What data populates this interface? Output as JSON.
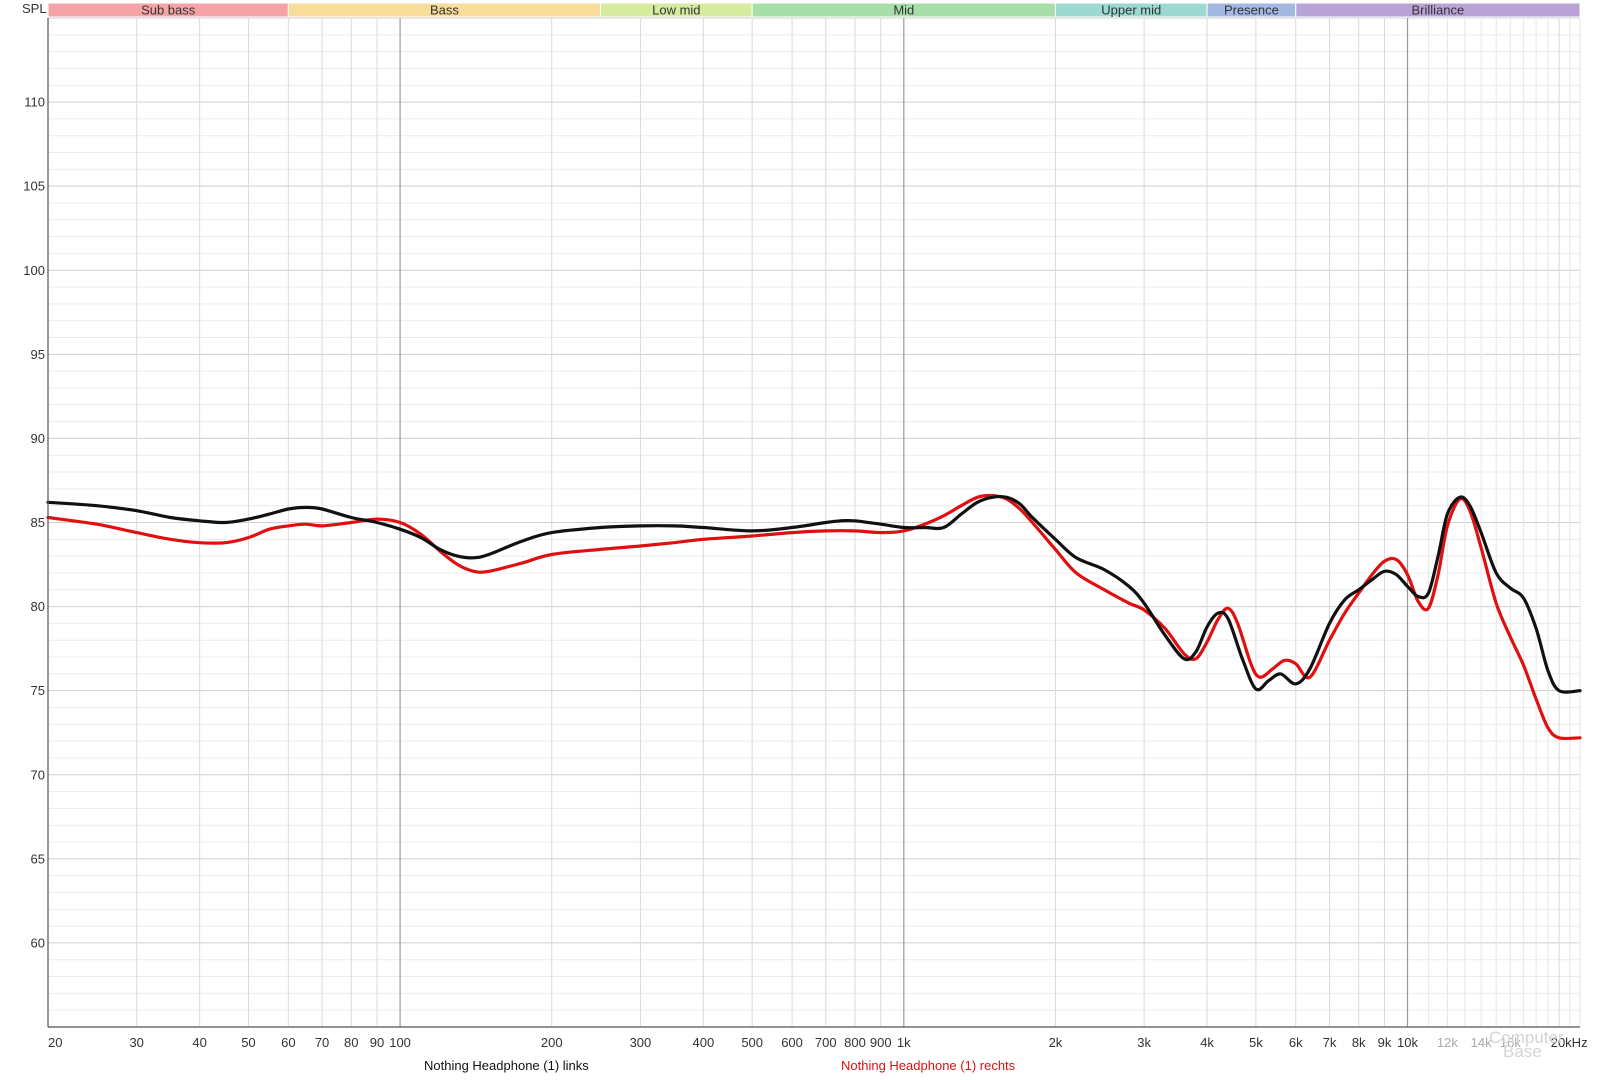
{
  "chart_data": {
    "type": "line",
    "ylabel": "SPL",
    "xunit": "kHz",
    "xscale": "log",
    "xlim": [
      20,
      22000
    ],
    "ylim": [
      55,
      115
    ],
    "y_ticks": [
      60,
      65,
      70,
      75,
      80,
      85,
      90,
      95,
      100,
      105,
      110
    ],
    "x_ticks": [
      {
        "value": 20,
        "label": "20"
      },
      {
        "value": 30,
        "label": "30"
      },
      {
        "value": 40,
        "label": "40"
      },
      {
        "value": 50,
        "label": "50"
      },
      {
        "value": 60,
        "label": "60"
      },
      {
        "value": 70,
        "label": "70"
      },
      {
        "value": 80,
        "label": "80"
      },
      {
        "value": 90,
        "label": "90"
      },
      {
        "value": 100,
        "label": "100"
      },
      {
        "value": 200,
        "label": "200"
      },
      {
        "value": 300,
        "label": "300"
      },
      {
        "value": 400,
        "label": "400"
      },
      {
        "value": 500,
        "label": "500"
      },
      {
        "value": 600,
        "label": "600"
      },
      {
        "value": 700,
        "label": "700"
      },
      {
        "value": 800,
        "label": "800"
      },
      {
        "value": 900,
        "label": "900"
      },
      {
        "value": 1000,
        "label": "1k"
      },
      {
        "value": 2000,
        "label": "2k"
      },
      {
        "value": 3000,
        "label": "3k"
      },
      {
        "value": 4000,
        "label": "4k"
      },
      {
        "value": 5000,
        "label": "5k"
      },
      {
        "value": 6000,
        "label": "6k"
      },
      {
        "value": 7000,
        "label": "7k"
      },
      {
        "value": 8000,
        "label": "8k"
      },
      {
        "value": 9000,
        "label": "9k"
      },
      {
        "value": 10000,
        "label": "10k"
      },
      {
        "value": 12000,
        "label": "12k"
      },
      {
        "value": 14000,
        "label": "14k"
      },
      {
        "value": 16000,
        "label": "16k"
      },
      {
        "value": 20000,
        "label": "20kHz"
      }
    ],
    "bands": [
      {
        "name": "Sub bass",
        "from": 20,
        "to": 60,
        "color": "#f4a3a6"
      },
      {
        "name": "Bass",
        "from": 60,
        "to": 250,
        "color": "#f7dc9a"
      },
      {
        "name": "Low mid",
        "from": 250,
        "to": 500,
        "color": "#d6eaa0"
      },
      {
        "name": "Mid",
        "from": 500,
        "to": 2000,
        "color": "#a6e0a8"
      },
      {
        "name": "Upper mid",
        "from": 2000,
        "to": 4000,
        "color": "#9cd9d0"
      },
      {
        "name": "Presence",
        "from": 4000,
        "to": 6000,
        "color": "#a3b9e2"
      },
      {
        "name": "Brilliance",
        "from": 6000,
        "to": 22000,
        "color": "#b9a3d6"
      }
    ],
    "grid": true,
    "series": [
      {
        "name": "Nothing Headphone (1) links",
        "color": "#111111",
        "points": [
          [
            20,
            86.2
          ],
          [
            25,
            86.0
          ],
          [
            30,
            85.7
          ],
          [
            35,
            85.3
          ],
          [
            40,
            85.1
          ],
          [
            45,
            85.0
          ],
          [
            50,
            85.2
          ],
          [
            55,
            85.5
          ],
          [
            60,
            85.8
          ],
          [
            65,
            85.9
          ],
          [
            70,
            85.8
          ],
          [
            80,
            85.3
          ],
          [
            90,
            85.0
          ],
          [
            100,
            84.6
          ],
          [
            110,
            84.1
          ],
          [
            120,
            83.4
          ],
          [
            130,
            83.0
          ],
          [
            140,
            82.9
          ],
          [
            150,
            83.1
          ],
          [
            175,
            83.9
          ],
          [
            200,
            84.4
          ],
          [
            250,
            84.7
          ],
          [
            300,
            84.8
          ],
          [
            350,
            84.8
          ],
          [
            400,
            84.7
          ],
          [
            500,
            84.5
          ],
          [
            600,
            84.7
          ],
          [
            700,
            85.0
          ],
          [
            750,
            85.1
          ],
          [
            800,
            85.1
          ],
          [
            900,
            84.9
          ],
          [
            1000,
            84.7
          ],
          [
            1100,
            84.7
          ],
          [
            1200,
            84.7
          ],
          [
            1300,
            85.5
          ],
          [
            1400,
            86.2
          ],
          [
            1500,
            86.5
          ],
          [
            1600,
            86.5
          ],
          [
            1700,
            86.1
          ],
          [
            1800,
            85.3
          ],
          [
            2000,
            84.0
          ],
          [
            2200,
            82.9
          ],
          [
            2500,
            82.2
          ],
          [
            2800,
            81.2
          ],
          [
            3000,
            80.2
          ],
          [
            3300,
            78.3
          ],
          [
            3600,
            76.9
          ],
          [
            3800,
            77.3
          ],
          [
            4000,
            78.8
          ],
          [
            4200,
            79.6
          ],
          [
            4400,
            79.3
          ],
          [
            4700,
            76.9
          ],
          [
            5000,
            75.1
          ],
          [
            5300,
            75.6
          ],
          [
            5600,
            76.0
          ],
          [
            6000,
            75.4
          ],
          [
            6400,
            76.3
          ],
          [
            7000,
            79.0
          ],
          [
            7500,
            80.4
          ],
          [
            8000,
            81.0
          ],
          [
            8500,
            81.6
          ],
          [
            9000,
            82.1
          ],
          [
            9500,
            81.9
          ],
          [
            10000,
            81.2
          ],
          [
            10500,
            80.6
          ],
          [
            11000,
            80.8
          ],
          [
            11500,
            83.0
          ],
          [
            12000,
            85.5
          ],
          [
            12700,
            86.5
          ],
          [
            13300,
            86.0
          ],
          [
            14000,
            84.4
          ],
          [
            15000,
            82.0
          ],
          [
            16000,
            81.1
          ],
          [
            17000,
            80.5
          ],
          [
            18000,
            78.7
          ],
          [
            19000,
            76.2
          ],
          [
            20000,
            75.0
          ],
          [
            22000,
            75.0
          ]
        ]
      },
      {
        "name": "Nothing Headphone (1) rechts",
        "color": "#e01010",
        "points": [
          [
            20,
            85.3
          ],
          [
            25,
            84.9
          ],
          [
            30,
            84.4
          ],
          [
            35,
            84.0
          ],
          [
            40,
            83.8
          ],
          [
            45,
            83.8
          ],
          [
            50,
            84.1
          ],
          [
            55,
            84.6
          ],
          [
            60,
            84.8
          ],
          [
            65,
            84.9
          ],
          [
            70,
            84.8
          ],
          [
            80,
            85.0
          ],
          [
            90,
            85.2
          ],
          [
            100,
            85.0
          ],
          [
            110,
            84.3
          ],
          [
            120,
            83.3
          ],
          [
            130,
            82.5
          ],
          [
            140,
            82.1
          ],
          [
            150,
            82.1
          ],
          [
            175,
            82.6
          ],
          [
            200,
            83.1
          ],
          [
            250,
            83.4
          ],
          [
            300,
            83.6
          ],
          [
            350,
            83.8
          ],
          [
            400,
            84.0
          ],
          [
            500,
            84.2
          ],
          [
            600,
            84.4
          ],
          [
            700,
            84.5
          ],
          [
            800,
            84.5
          ],
          [
            900,
            84.4
          ],
          [
            1000,
            84.5
          ],
          [
            1100,
            84.9
          ],
          [
            1200,
            85.4
          ],
          [
            1300,
            86.0
          ],
          [
            1400,
            86.5
          ],
          [
            1500,
            86.6
          ],
          [
            1600,
            86.4
          ],
          [
            1700,
            85.8
          ],
          [
            1800,
            85.0
          ],
          [
            2000,
            83.4
          ],
          [
            2200,
            82.0
          ],
          [
            2500,
            81.0
          ],
          [
            2800,
            80.2
          ],
          [
            3000,
            79.8
          ],
          [
            3300,
            78.7
          ],
          [
            3600,
            77.2
          ],
          [
            3800,
            76.9
          ],
          [
            4000,
            77.9
          ],
          [
            4200,
            79.2
          ],
          [
            4400,
            79.9
          ],
          [
            4600,
            79.0
          ],
          [
            4900,
            76.5
          ],
          [
            5100,
            75.8
          ],
          [
            5400,
            76.3
          ],
          [
            5700,
            76.8
          ],
          [
            6000,
            76.6
          ],
          [
            6400,
            75.8
          ],
          [
            7000,
            78.0
          ],
          [
            7500,
            79.6
          ],
          [
            8000,
            80.8
          ],
          [
            8500,
            81.9
          ],
          [
            9000,
            82.7
          ],
          [
            9500,
            82.8
          ],
          [
            10000,
            81.9
          ],
          [
            10500,
            80.3
          ],
          [
            11000,
            79.9
          ],
          [
            11500,
            81.9
          ],
          [
            12000,
            84.8
          ],
          [
            12700,
            86.4
          ],
          [
            13300,
            85.7
          ],
          [
            14000,
            83.5
          ],
          [
            15000,
            80.2
          ],
          [
            16000,
            78.2
          ],
          [
            17000,
            76.5
          ],
          [
            18000,
            74.5
          ],
          [
            19000,
            72.8
          ],
          [
            20000,
            72.2
          ],
          [
            22000,
            72.2
          ]
        ]
      }
    ]
  },
  "watermark": {
    "line1": "Computer",
    "line2": "Base"
  }
}
